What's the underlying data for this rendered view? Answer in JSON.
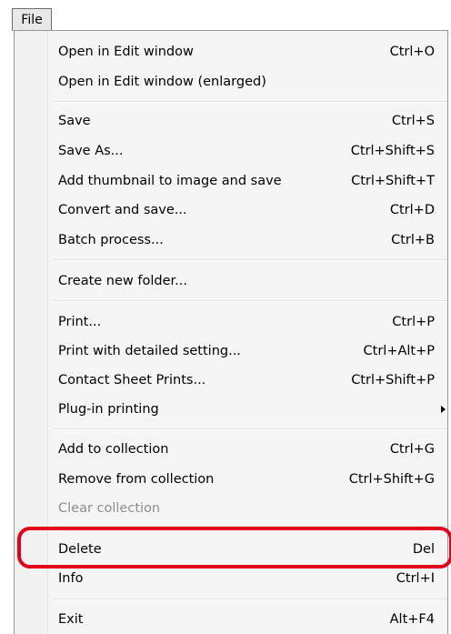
{
  "menubar": {
    "file_label": "File"
  },
  "menu": {
    "items": [
      {
        "label": "Open in Edit window",
        "shortcut": "Ctrl+O"
      },
      {
        "label": "Open in Edit window (enlarged)",
        "shortcut": ""
      },
      {
        "label": "Save",
        "shortcut": "Ctrl+S"
      },
      {
        "label": "Save As...",
        "shortcut": "Ctrl+Shift+S"
      },
      {
        "label": "Add thumbnail to image and save",
        "shortcut": "Ctrl+Shift+T"
      },
      {
        "label": "Convert and save...",
        "shortcut": "Ctrl+D"
      },
      {
        "label": "Batch process...",
        "shortcut": "Ctrl+B"
      },
      {
        "label": "Create new folder...",
        "shortcut": ""
      },
      {
        "label": "Print...",
        "shortcut": "Ctrl+P"
      },
      {
        "label": "Print with detailed setting...",
        "shortcut": "Ctrl+Alt+P"
      },
      {
        "label": "Contact Sheet Prints...",
        "shortcut": "Ctrl+Shift+P"
      },
      {
        "label": "Plug-in printing",
        "shortcut": "",
        "submenu_icon": "chevron-right-icon"
      },
      {
        "label": "Add to collection",
        "shortcut": "Ctrl+G"
      },
      {
        "label": "Remove from collection",
        "shortcut": "Ctrl+Shift+G"
      },
      {
        "label": "Clear collection",
        "shortcut": "",
        "disabled": true
      },
      {
        "label": "Delete",
        "shortcut": "Del",
        "highlighted": true
      },
      {
        "label": "Info",
        "shortcut": "Ctrl+I"
      },
      {
        "label": "Exit",
        "shortcut": "Alt+F4"
      }
    ]
  },
  "colors": {
    "highlight_outline": "#e5001c",
    "disabled_text": "#8d8d8d",
    "menu_background": "#f5f5f5"
  }
}
